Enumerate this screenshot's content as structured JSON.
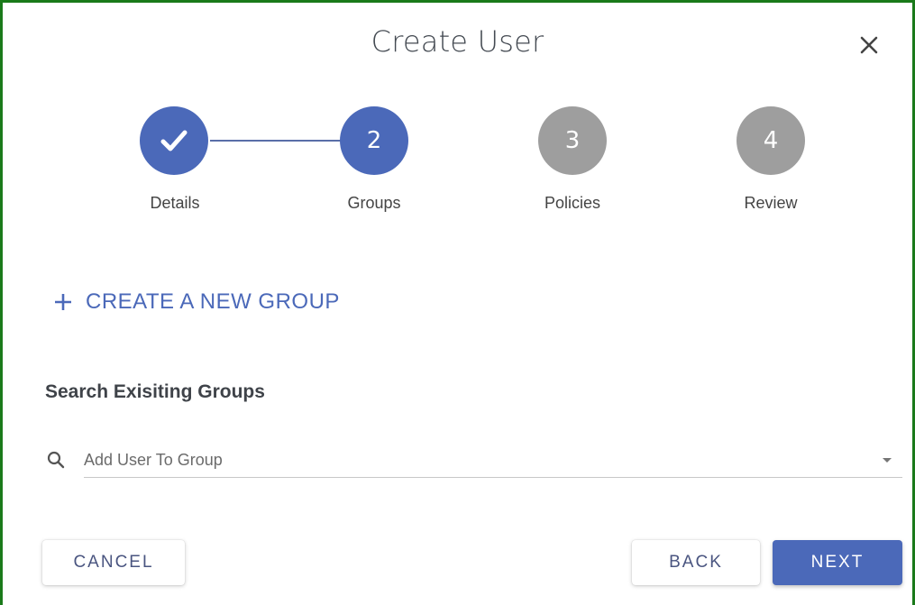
{
  "dialog": {
    "title": "Create User",
    "close_icon": "close-icon"
  },
  "stepper": {
    "steps": [
      {
        "label": "Details",
        "number": "1",
        "state": "completed",
        "icon": "check-icon"
      },
      {
        "label": "Groups",
        "number": "2",
        "state": "active"
      },
      {
        "label": "Policies",
        "number": "3",
        "state": "pending"
      },
      {
        "label": "Review",
        "number": "4",
        "state": "pending"
      }
    ],
    "colors": {
      "active": "#4b69b9",
      "pending": "#9e9e9e"
    }
  },
  "create_group": {
    "label": "CREATE A NEW GROUP",
    "icon": "plus-icon"
  },
  "search_section": {
    "heading": "Search Exisiting Groups",
    "search_icon": "search-icon",
    "input_value": "",
    "placeholder": "Add User To Group",
    "dropdown_icon": "dropdown-arrow-icon"
  },
  "footer": {
    "cancel_label": "CANCEL",
    "back_label": "BACK",
    "next_label": "NEXT"
  },
  "theme": {
    "accent": "#4b69b9",
    "frame_border": "#1a7a1a"
  }
}
